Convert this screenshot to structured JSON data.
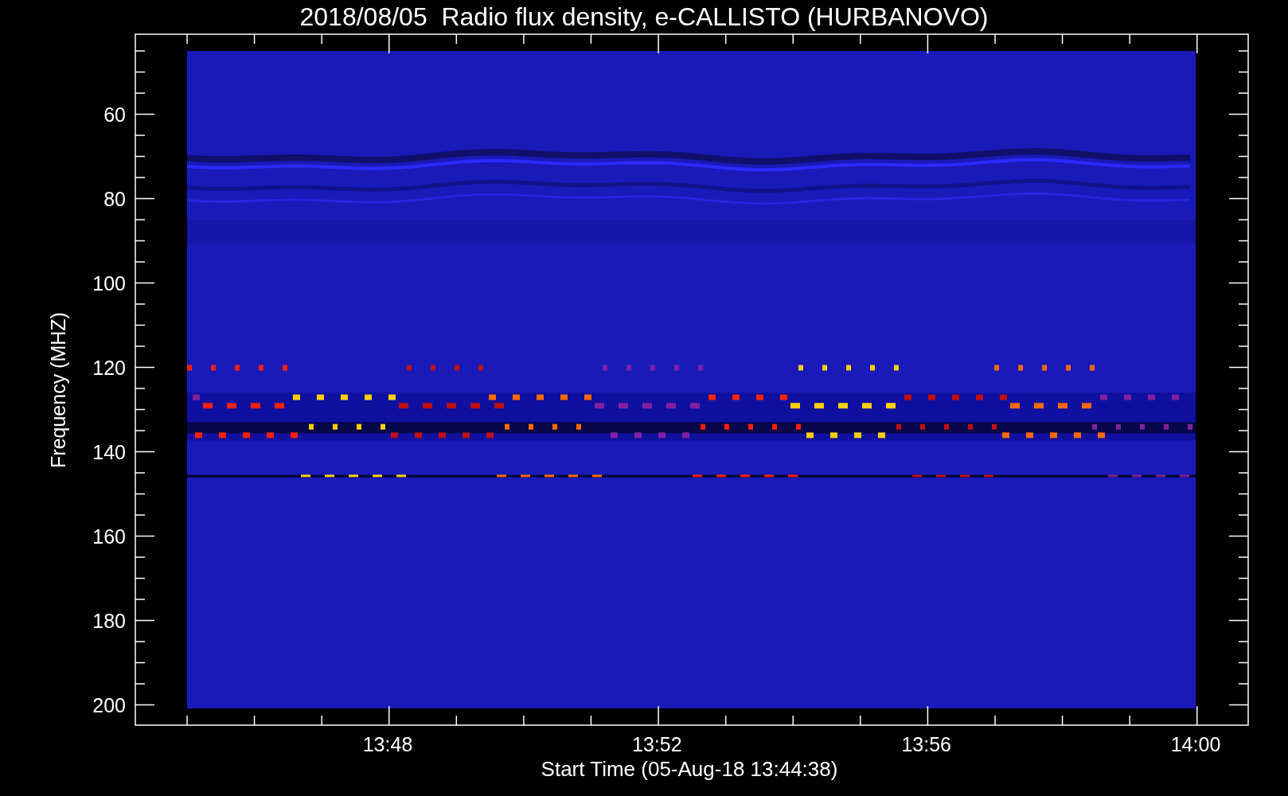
{
  "title": "2018/08/05  Radio flux density, e-CALLISTO (HURBANOVO)",
  "y_axis": {
    "label": "Frequency (MHZ)",
    "ticks": [
      "60",
      "80",
      "100",
      "120",
      "140",
      "160",
      "180",
      "200"
    ]
  },
  "x_axis": {
    "label": "Start Time (05-Aug-18 13:44:38)",
    "ticks": [
      "13:48",
      "13:52",
      "13:56",
      "14:00"
    ]
  }
}
